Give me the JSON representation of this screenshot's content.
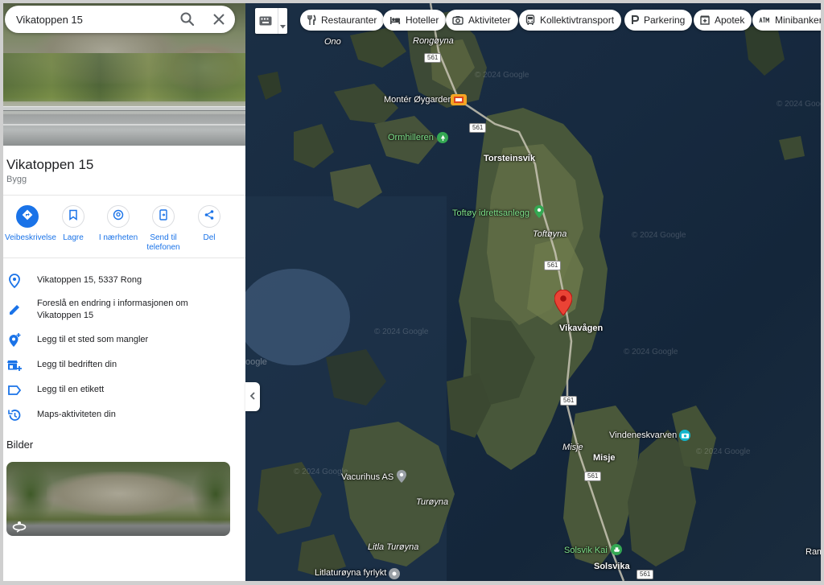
{
  "search": {
    "value": "Vikatoppen 15"
  },
  "place": {
    "title": "Vikatoppen 15",
    "subtitle": "Bygg"
  },
  "actions": [
    {
      "label": "Veibeskrivelse"
    },
    {
      "label": "Lagre"
    },
    {
      "label": "I nærheten"
    },
    {
      "label": "Send til telefonen"
    },
    {
      "label": "Del"
    }
  ],
  "info_rows": [
    {
      "icon": "location-pin-icon",
      "text": "Vikatoppen 15, 5337 Rong"
    },
    {
      "icon": "pencil-icon",
      "text": "Foreslå en endring i informasjonen om Vikatoppen 15"
    },
    {
      "icon": "add-place-icon",
      "text": "Legg til et sted som mangler"
    },
    {
      "icon": "add-business-icon",
      "text": "Legg til bedriften din"
    },
    {
      "icon": "label-icon",
      "text": "Legg til en etikett"
    },
    {
      "icon": "history-icon",
      "text": "Maps-aktiviteten din"
    }
  ],
  "photos": {
    "heading": "Bilder"
  },
  "chips": [
    {
      "icon": "restaurant-icon",
      "label": "Restauranter"
    },
    {
      "icon": "hotel-icon",
      "label": "Hoteller"
    },
    {
      "icon": "camera-icon",
      "label": "Aktiviteter"
    },
    {
      "icon": "bus-icon",
      "label": "Kollektivtransport"
    },
    {
      "icon": "parking-icon",
      "label": "Parkering"
    },
    {
      "icon": "pharmacy-icon",
      "label": "Apotek"
    },
    {
      "icon": "atm-icon",
      "label": "Minibanker"
    }
  ],
  "map": {
    "watermark": "© 2024 Google",
    "labels": {
      "ono": "Ono",
      "rongoyna": "Rongøyna",
      "monter": "Montér Øygarden",
      "ormhilleren": "Ormhilleren",
      "torsteinsvik": "Torsteinsvik",
      "toftoy_idrett": "Toftøy idrettsanlegg",
      "toftoyna": "Toftøyna",
      "vikavagen": "Vikavågen",
      "vindeneskvarven": "Vindeneskvarven",
      "misje_italic": "Misje",
      "misje": "Misje",
      "vacurihus": "Vacurihus AS",
      "turoyna": "Turøyna",
      "litla_turoyna": "Litla Turøyna",
      "litlaturoyna_fyrlykt": "Litlaturøyna fyrlykt",
      "solsvik_kai": "Solsvik Kai",
      "solsvika": "Solsvika",
      "ram": "Ram",
      "google_edge": "oogle"
    },
    "road_number": "561",
    "pin_color": "#ea4335"
  },
  "colors": {
    "accent": "#1a73e8"
  }
}
